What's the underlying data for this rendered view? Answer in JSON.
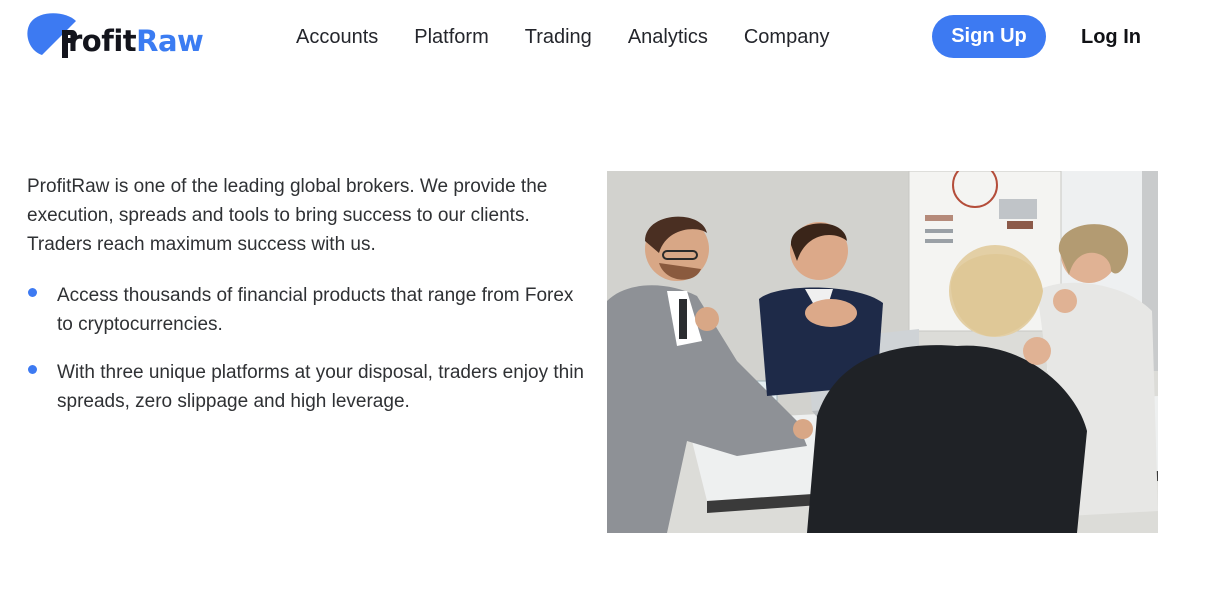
{
  "brand": {
    "name_part1": "rofit",
    "name_part2": "Raw",
    "colors": {
      "accent": "#3d7af2",
      "dark": "#13141c"
    }
  },
  "nav": {
    "items": [
      {
        "label": "Accounts"
      },
      {
        "label": "Platform"
      },
      {
        "label": "Trading"
      },
      {
        "label": "Analytics"
      },
      {
        "label": "Company"
      }
    ]
  },
  "header": {
    "signup_label": "Sign Up",
    "login_label": "Log In"
  },
  "main": {
    "intro": "ProfitRaw is one of the leading global brokers. We provide the execution, spreads and tools to bring success to our clients. Traders reach maximum success with us.",
    "bullets": [
      {
        "text": "Access thousands of financial products that range from Forex to cryptocurrencies."
      },
      {
        "text": "With three unique platforms at your disposal, traders enjoy thin spreads, zero slippage and high leverage."
      }
    ],
    "photo_icon": "business-meeting-photo"
  }
}
